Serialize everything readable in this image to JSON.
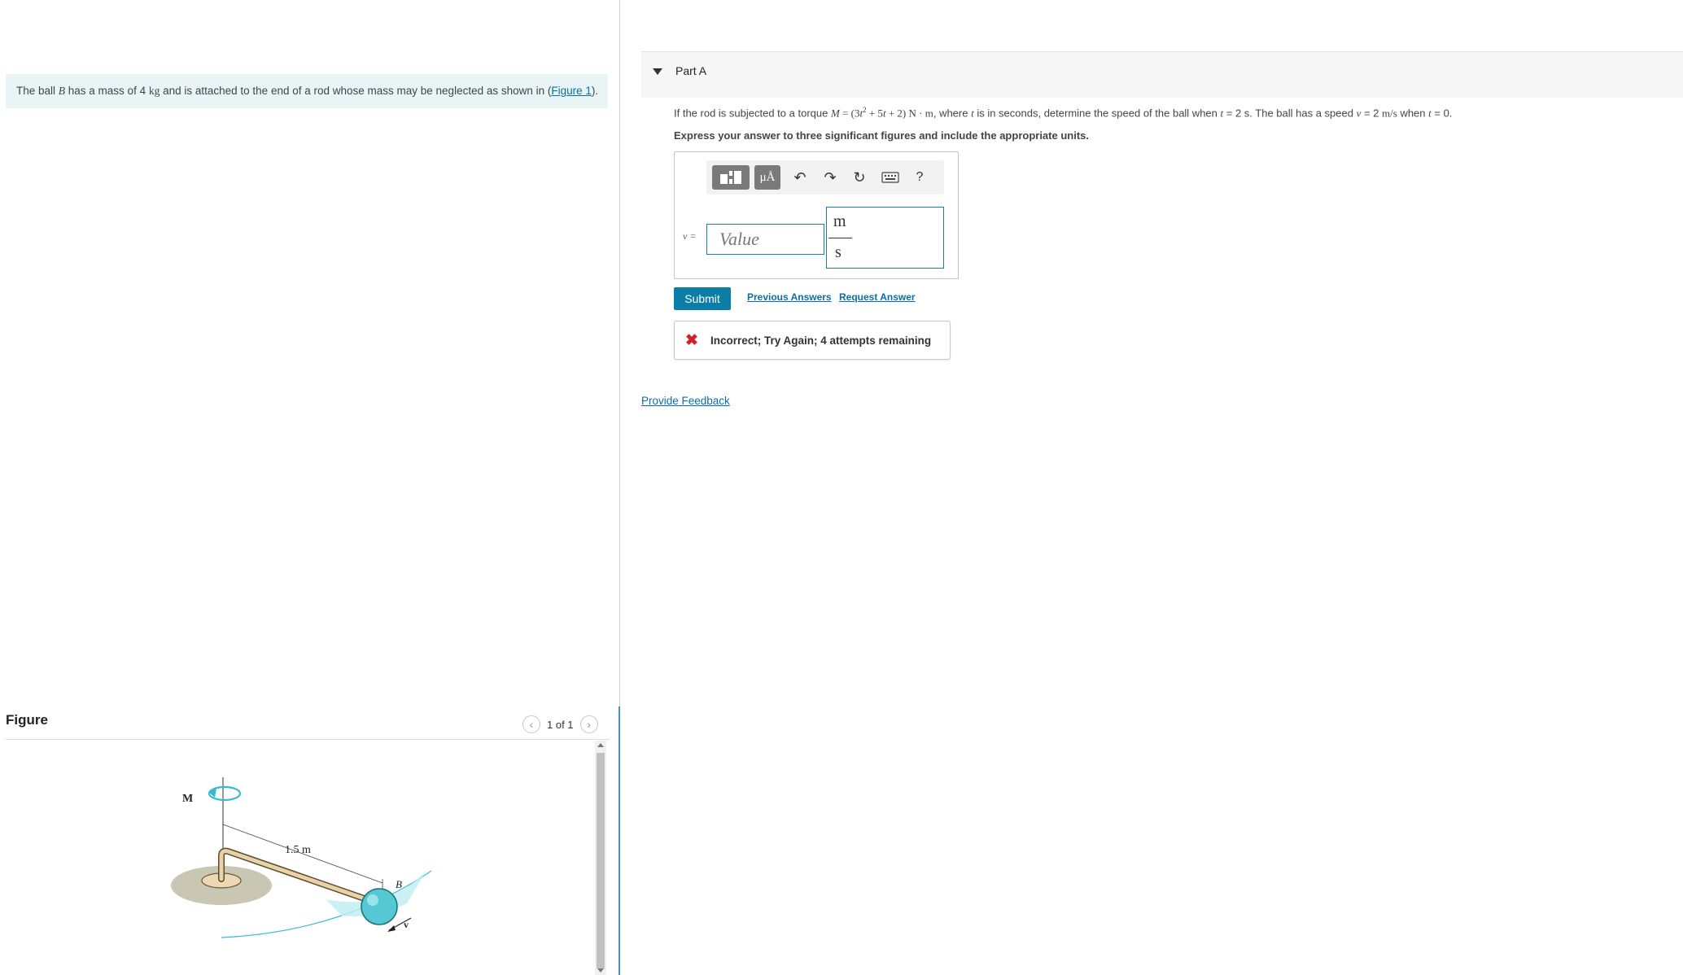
{
  "problem": {
    "intro_before_var": "The ball ",
    "var_B": "B",
    "intro_mid": " has a mass of 4 ",
    "unit_kg": "kg",
    "intro_after": " and is attached to the end of a rod whose mass may be neglected as shown in (",
    "figure_link": "Figure 1",
    "intro_end": ")."
  },
  "figure": {
    "title": "Figure",
    "counter": "1 of 1",
    "labels": {
      "M": "M",
      "length": "1.5 m",
      "B": "B",
      "v": "v"
    }
  },
  "part": {
    "title": "Part A",
    "question": {
      "q1": "If the rod is subjected to a torque ",
      "M": "M",
      "eq": " = (3",
      "t1": "t",
      "sq": "2",
      "plus1": " + 5",
      "t2": "t",
      "plus2": " + 2) ",
      "unit": "N · m",
      "q2": ", where ",
      "t3": "t",
      "q3": " is in seconds, determine the speed of the ball when ",
      "t4": "t",
      "q4": " = 2 s. The ball has a speed ",
      "v": "v",
      "q5": " = 2 ",
      "speed_unit": "m/s",
      "q6": " when ",
      "t5": "t",
      "q7": " = 0."
    },
    "instruction": "Express your answer to three significant figures and include the appropriate units."
  },
  "answer": {
    "toolbar": {
      "units_label": "μÅ",
      "undo": "↶",
      "redo": "↷",
      "reset": "↻",
      "help": "?"
    },
    "variable_label": "v =",
    "value_placeholder": "Value",
    "value": "",
    "unit_numerator": "m",
    "unit_denominator": "s"
  },
  "actions": {
    "submit": "Submit",
    "previous_answers": "Previous Answers",
    "request_answer": "Request Answer"
  },
  "feedback": {
    "icon": "✖",
    "text": "Incorrect; Try Again; 4 attempts remaining"
  },
  "provide_feedback": "Provide Feedback",
  "colors": {
    "accent": "#0a7ea6",
    "error": "#d0202e",
    "intro_bg": "#e8f4f6",
    "ball": "#55c8d3"
  }
}
